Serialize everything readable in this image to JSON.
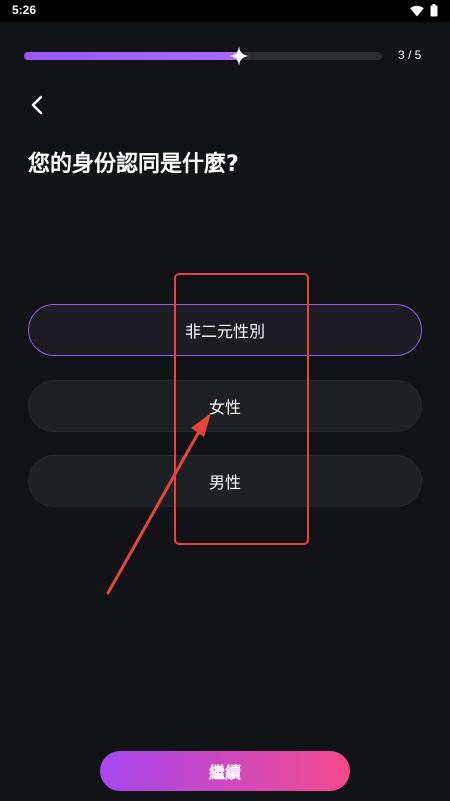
{
  "status_bar": {
    "time": "5:26",
    "icons": [
      "wifi-icon",
      "battery-icon"
    ]
  },
  "progress": {
    "label": "3 / 5",
    "current": 3,
    "total": 5,
    "fraction": 0.6
  },
  "question": {
    "title": "您的身份認同是什麼?"
  },
  "options": [
    {
      "label": "非二元性別",
      "selected": true
    },
    {
      "label": "女性",
      "selected": false
    },
    {
      "label": "男性",
      "selected": false
    }
  ],
  "continue_button": {
    "label": "繼續"
  },
  "colors": {
    "background": "#121316",
    "accent": "#9b59f0",
    "option_bg": "#1f2024",
    "selected_border": "#8f5ee6",
    "button_gradient_start": "#a748f0",
    "button_gradient_end": "#f24a8c",
    "annotation": "#e5453b"
  }
}
